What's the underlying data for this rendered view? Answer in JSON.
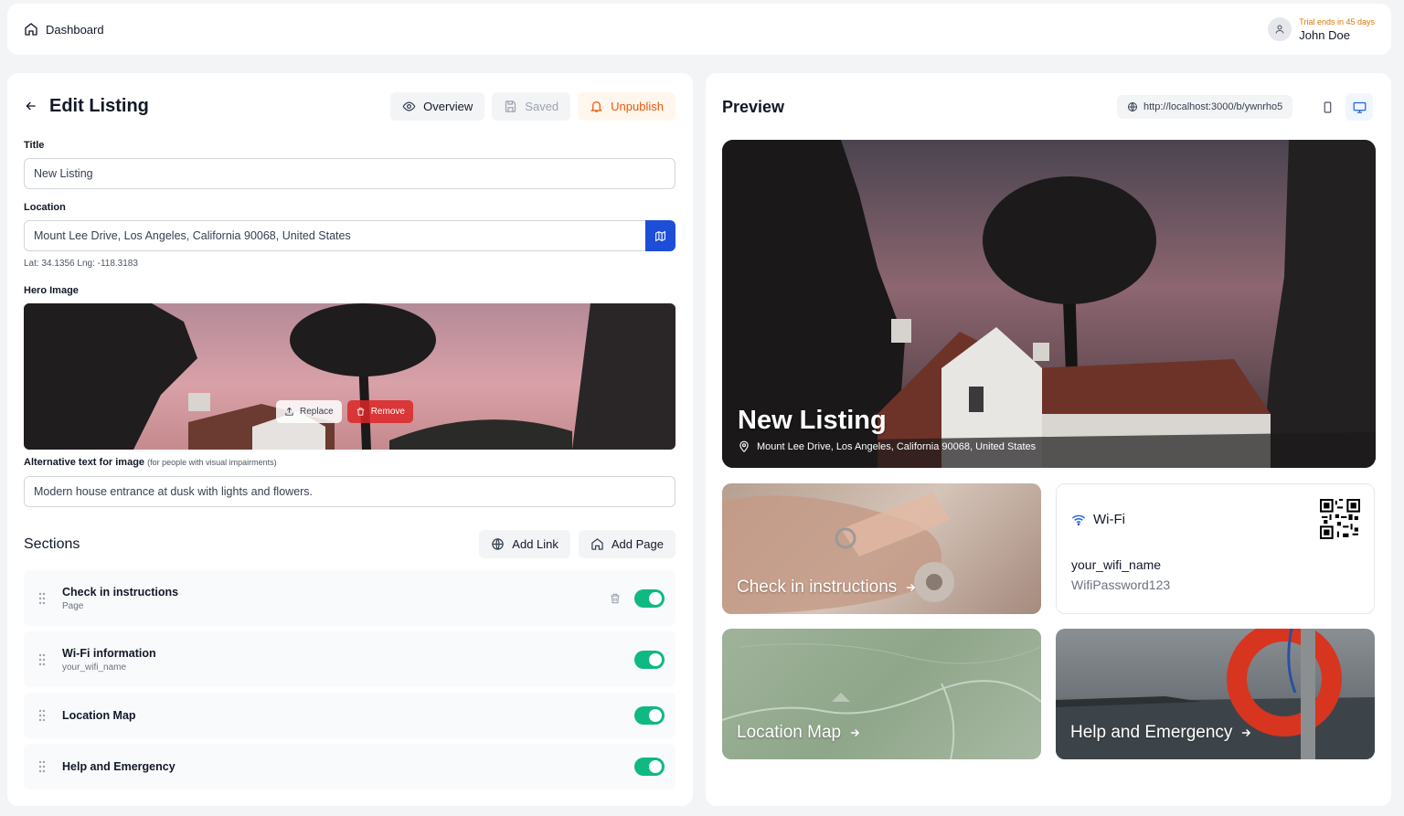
{
  "topbar": {
    "brand": "Dashboard",
    "trial": "Trial ends in 45 days",
    "user": "John Doe"
  },
  "edit": {
    "title": "Edit Listing",
    "overview_label": "Overview",
    "saved_label": "Saved",
    "unpublish_label": "Unpublish",
    "title_label": "Title",
    "title_value": "New Listing",
    "location_label": "Location",
    "location_value": "Mount Lee Drive, Los Angeles, California 90068, United States",
    "coords": "Lat: 34.1356   Lng: -118.3183",
    "hero_label": "Hero Image",
    "replace_label": "Replace",
    "remove_label": "Remove",
    "alt_label": "Alternative text for image",
    "alt_hint": "(for people with visual impairments)",
    "alt_value": "Modern house entrance at dusk with lights and flowers."
  },
  "sections": {
    "title": "Sections",
    "add_link": "Add Link",
    "add_page": "Add Page",
    "items": [
      {
        "name": "Check in instructions",
        "sub": "Page",
        "enabled": true
      },
      {
        "name": "Wi-Fi information",
        "sub": "your_wifi_name",
        "enabled": true
      },
      {
        "name": "Location Map",
        "sub": "",
        "enabled": true
      },
      {
        "name": "Help and Emergency",
        "sub": "",
        "enabled": true
      }
    ]
  },
  "preview": {
    "title": "Preview",
    "url": "http://localhost:3000/b/ywnrho5",
    "hero_title": "New Listing",
    "hero_location": "Mount Lee Drive, Los Angeles, California 90068, United States",
    "cards": {
      "checkin": "Check in instructions",
      "wifi_title": "Wi-Fi",
      "wifi_name": "your_wifi_name",
      "wifi_password": "WifiPassword123",
      "map": "Location Map",
      "help": "Help and Emergency"
    }
  },
  "colors": {
    "accent": "#1d4ed8",
    "toggle": "#10b981",
    "warning": "#ea580c",
    "trial": "#d97706"
  }
}
